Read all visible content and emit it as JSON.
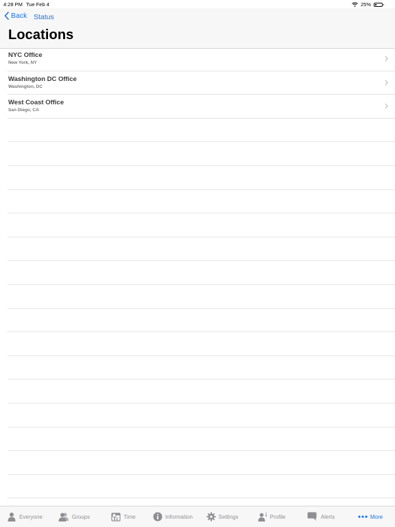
{
  "status_bar": {
    "time": "4:28 PM",
    "date": "Tue Feb 4",
    "battery": "25%",
    "battery_level": 0.25
  },
  "nav": {
    "back_label": "Back",
    "status_label": "Status",
    "title": "Locations"
  },
  "locations": [
    {
      "name": "NYC Office",
      "city": "New York, NY"
    },
    {
      "name": "Washington DC Office",
      "city": "Washington, DC"
    },
    {
      "name": "West Coast Office",
      "city": "San Diego, CA"
    }
  ],
  "tabs": [
    {
      "label": "Everyone",
      "icon": "person-icon"
    },
    {
      "label": "Groups",
      "icon": "group-icon"
    },
    {
      "label": "Time",
      "icon": "calendar-icon"
    },
    {
      "label": "Information",
      "icon": "info-icon"
    },
    {
      "label": "Settings",
      "icon": "gear-icon"
    },
    {
      "label": "Profile",
      "icon": "profile-icon"
    },
    {
      "label": "Alerts",
      "icon": "chat-bubble-icon"
    },
    {
      "label": "More",
      "icon": "more-dots-icon",
      "active": true
    }
  ],
  "colors": {
    "accent": "#1a73e8",
    "tab_inactive": "#8e8e93"
  }
}
